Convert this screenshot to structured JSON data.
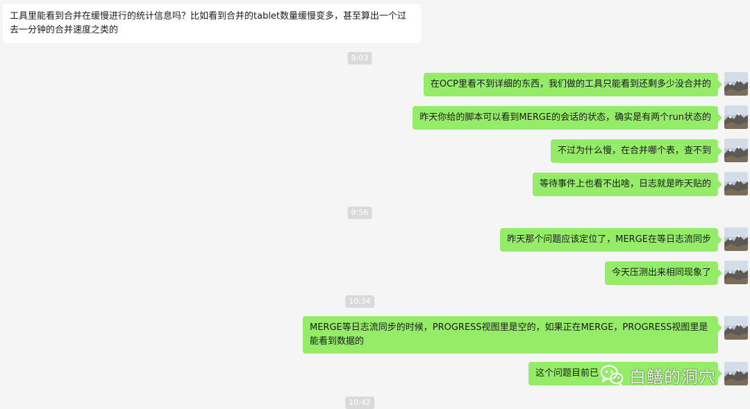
{
  "incoming_message": {
    "text": "工具里能看到合并在缓慢进行的统计信息吗？比如看到合并的tablet数量缓慢变多，甚至算出一个过去一分钟的合并速度之类的"
  },
  "timestamps": [
    "9:03",
    "9:56",
    "10:34",
    "10:42"
  ],
  "outgoing_messages": [
    "在OCP里看不到详细的东西，我们做的工具只能看到还剩多少没合并的",
    "昨天你给的脚本可以看到MERGE的会话的状态，确实是有两个run状态的",
    "不过为什么慢，在合并哪个表，查不到",
    "等待事件上也看不出啥，日志就是昨天贴的",
    "昨天那个问题应该定位了，MERGE在等日志流同步",
    "今天压测出来相同现象了",
    "MERGE等日志流同步的时候，PROGRESS视图里是空的，如果正在MERGE，PROGRESS视图里是能看到数据的",
    "这个问题目前已"
  ],
  "watermark": {
    "logo_icon": "wechat-icon",
    "text": "白鳝的洞穴"
  },
  "colors": {
    "background": "#f5f5f5",
    "incoming_bubble": "#ffffff",
    "outgoing_bubble": "#95ec69",
    "timestamp_bg": "#dadada"
  }
}
